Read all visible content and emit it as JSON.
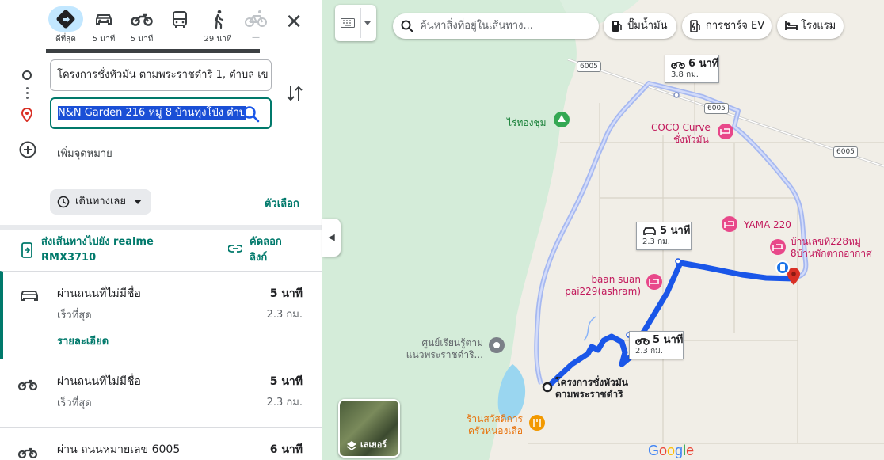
{
  "modes": [
    {
      "id": "best",
      "label": "ดีที่สุด",
      "icon": "best-route-icon"
    },
    {
      "id": "car",
      "label": "5 นาที",
      "icon": "car-icon"
    },
    {
      "id": "moto",
      "label": "5 นาที",
      "icon": "motorcycle-icon"
    },
    {
      "id": "transit",
      "label": "",
      "icon": "bus-icon"
    },
    {
      "id": "walk",
      "label": "29 นาที",
      "icon": "walk-icon"
    },
    {
      "id": "bike",
      "label": "—",
      "icon": "bicycle-icon"
    }
  ],
  "origin": "โครงการชั่งหัวมัน ตามพระราชดำริ 1, ตำบล เข",
  "destination": "N&N Garden 216 หมู่ 8 บ้านทุ่งโป่ง ตำบ",
  "add_destination": "เพิ่มจุดหมาย",
  "leave_now": "เดินทางเลย",
  "options": "ตัวเลือก",
  "send_to_device": "ส่งเส้นทางไปยัง realme RMX3710",
  "copy_link": "คัดลอกลิงก์",
  "routes": [
    {
      "title": "ผ่านถนนที่ไม่มีชื่อ",
      "sub": "เร็วที่สุด",
      "time": "5 นาที",
      "dist": "2.3 กม.",
      "details": "รายละเอียด",
      "icon": "car-icon"
    },
    {
      "title": "ผ่านถนนที่ไม่มีชื่อ",
      "sub": "เร็วที่สุด",
      "time": "5 นาที",
      "dist": "2.3 กม.",
      "icon": "motorcycle-icon"
    },
    {
      "title": "ผ่าน ถนนหมายเลข 6005",
      "time": "6 นาที",
      "icon": "motorcycle-icon"
    }
  ],
  "map": {
    "search_placeholder": "ค้นหาสิ่งที่อยู่ในเส้นทาง...",
    "chips": [
      "ปั๊มน้ำมัน",
      "การชาร์จ EV",
      "โรงแรม"
    ],
    "callouts": [
      {
        "time": "6 นาที",
        "dist": "3.8 กม.",
        "icon": "motorcycle-icon"
      },
      {
        "time": "5 นาที",
        "dist": "2.3 กม.",
        "icon": "car-icon"
      },
      {
        "time": "5 นาที",
        "dist": "2.3 กม.",
        "icon": "motorcycle-icon"
      }
    ],
    "places": {
      "rai": "ไร่ทองชุม",
      "coco1": "COCO Curve",
      "coco2": "ชั่งหัวมัน",
      "yama": "YAMA 220",
      "baan1": "บ้านเลขที่228หมู่",
      "baan2": "8บ้านพักตากอากาศ",
      "suan1": "baan suan",
      "suan2": "pai229(ashram)",
      "learn1": "ศูนย์เรียนรู้ตาม",
      "learn2": "แนวพระราชดำริ...",
      "origin1": "โครงการชั่งหัวมัน",
      "origin2": "ตามพระราชดำริ",
      "shop1": "ร้านสวัสดิการ",
      "shop2": "ครัวหนองเสือ"
    },
    "road_shield": "6005",
    "layers": "เลเยอร์",
    "google": "Google"
  },
  "colors": {
    "accent": "#00796b",
    "route_main": "#1a56e8",
    "route_alt": "#a6b8f0",
    "pin": "#d93025",
    "poi_pink": "#e8488a"
  }
}
